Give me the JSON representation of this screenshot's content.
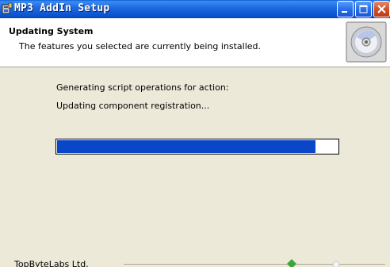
{
  "window": {
    "title": "MP3 AddIn Setup",
    "icons": {
      "app": "installer-icon",
      "minimize": "minimize-icon",
      "maximize": "maximize-icon",
      "close": "close-icon"
    }
  },
  "header": {
    "title": "Updating System",
    "subtitle": "The features you selected are currently being installed.",
    "icon": "cd-disc-icon"
  },
  "status": {
    "label": "Generating script operations for action:",
    "action": "Updating component registration..."
  },
  "progress": {
    "percent": 92,
    "color": "#0a47c8"
  },
  "footer": {
    "brand": "TopByteLabs Ltd."
  }
}
